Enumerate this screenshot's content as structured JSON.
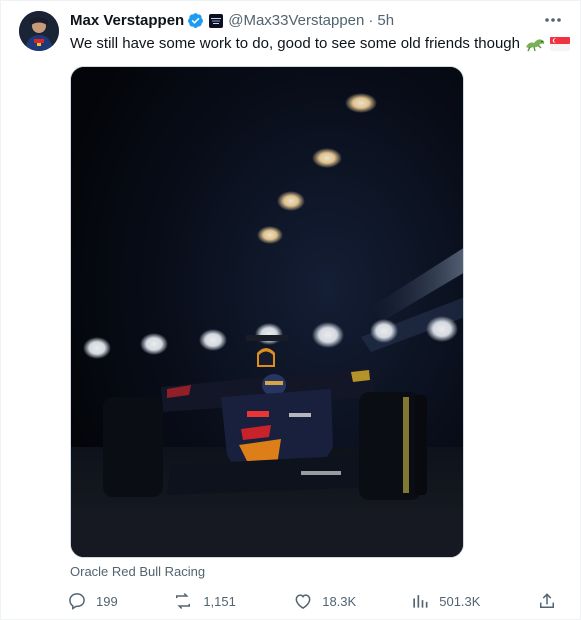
{
  "tweet": {
    "author": {
      "name": "Max Verstappen",
      "handle": "@Max33Verstappen",
      "separator": "·",
      "time": "5h"
    },
    "text": "We still have some work to do, good to see some old friends though",
    "emojis": [
      "lizard-emoji",
      "singapore-flag-emoji"
    ],
    "media": {
      "alt_icon": "f1-car-night-photo"
    },
    "caption": "Oracle Red Bull Racing",
    "stats": {
      "replies": "199",
      "reposts": "1,151",
      "likes": "18.3K",
      "views": "501.3K"
    }
  },
  "colors": {
    "verified_blue": "#1d9bf0",
    "secondary_text": "#536471",
    "primary_text": "#0f1419",
    "repost_green": "#00ba7c"
  }
}
